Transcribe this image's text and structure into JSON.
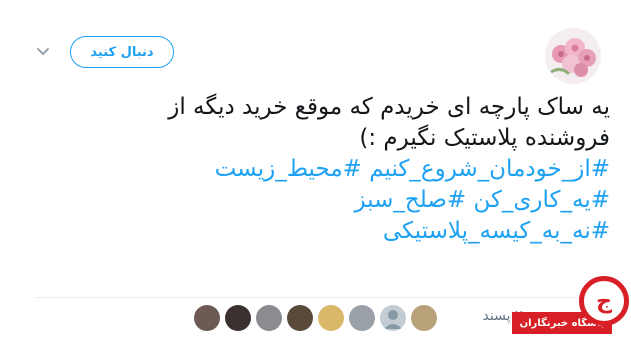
{
  "header": {
    "follow_label": "دنبال کنید",
    "profile_avatar_icon": "pink-roses-avatar",
    "caret_icon": "chevron-down-icon"
  },
  "tweet": {
    "line1": "یه ساک پارچه ای خریدم که موقع خرید دیگه از",
    "line2": "فروشنده پلاستیک نگیرم :)",
    "hashtag1": "#از_خودمان_شروع_کنیم",
    "hashtag2": "#محیط_زیست",
    "hashtag3": "#یه_کاری_کن",
    "hashtag4": "#صلح_سبز",
    "hashtag5": "#نه_به_کیسه_پلاستیکی"
  },
  "footer": {
    "likes_text": "۲۰ پسند",
    "likers_count": 8
  },
  "watermark": {
    "label": "باشگاه خبرنگاران"
  },
  "colors": {
    "accent": "#1da1f2",
    "text": "#14171a",
    "muted": "#657786",
    "divider": "#e6ecf0",
    "watermark_red": "#d81f26"
  }
}
